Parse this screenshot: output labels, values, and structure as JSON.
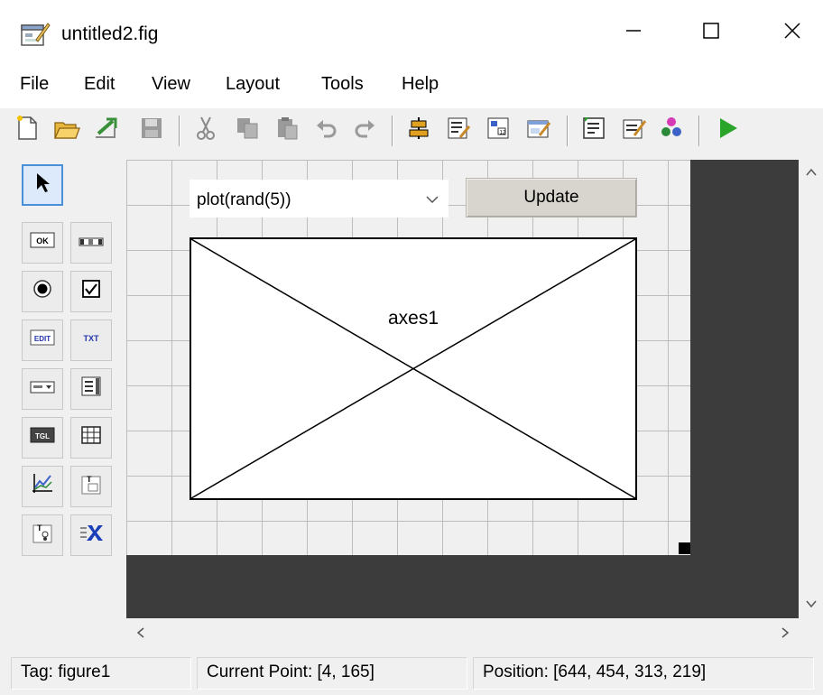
{
  "window": {
    "title": "untitled2.fig",
    "controls": [
      "minimize-icon",
      "maximize-icon",
      "close-icon"
    ]
  },
  "menu": {
    "items": [
      "File",
      "Edit",
      "View",
      "Layout",
      "Tools",
      "Help"
    ]
  },
  "toolbar": {
    "buttons": [
      "new-icon",
      "open-icon",
      "export-icon",
      "save-icon",
      "cut-icon",
      "copy-icon",
      "paste-icon",
      "undo-icon",
      "redo-icon",
      "align-icon",
      "menu-editor-icon",
      "tab-order-icon",
      "toolbar-editor-icon",
      "editor-icon",
      "property-inspector-icon",
      "object-browser-icon",
      "run-icon"
    ],
    "colors": {
      "run": "#2aa52a",
      "disabled": "#9a9a9a"
    }
  },
  "palette": {
    "items": [
      "select-arrow-icon",
      "pushbutton-icon",
      "slider-icon",
      "radiobutton-icon",
      "checkbox-icon",
      "edit-text-icon",
      "static-text-icon",
      "popup-menu-icon",
      "listbox-icon",
      "toggle-button-icon",
      "table-icon",
      "axes-icon",
      "panel-icon",
      "button-group-icon",
      "activex-icon"
    ],
    "labels": {
      "pushbutton": "OK",
      "edit": "EDIT",
      "text": "TXT",
      "toggle": "TGL"
    }
  },
  "canvas": {
    "popup": {
      "value": "plot(rand(5))"
    },
    "update_button": {
      "label": "Update"
    },
    "axes": {
      "label": "axes1"
    },
    "colors": {
      "background": "#f0f0f0",
      "outside": "#3c3c3c",
      "grid": "#bdbdbd"
    }
  },
  "status": {
    "tag": "Tag: figure1",
    "current_point": "Current Point:  [4, 165]",
    "position": "Position: [644, 454, 313, 219]"
  }
}
